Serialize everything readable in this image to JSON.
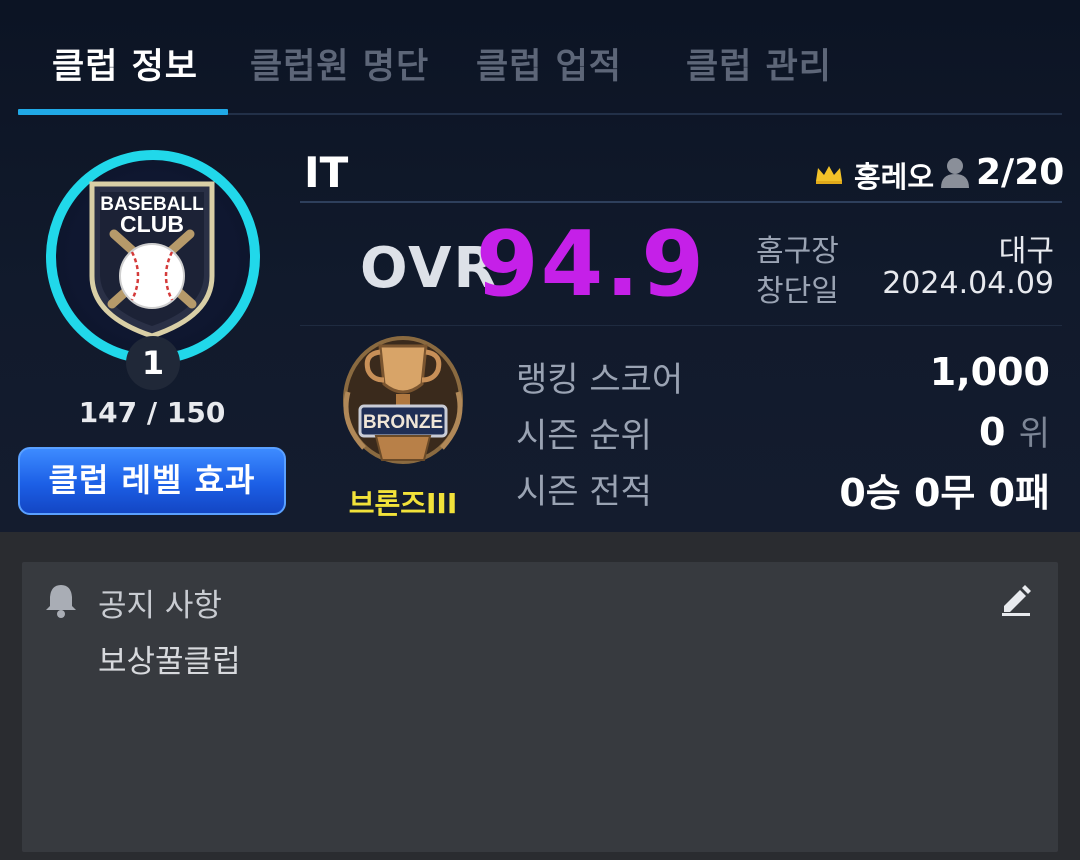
{
  "tabs": [
    {
      "label": "클럽 정보",
      "active": true
    },
    {
      "label": "클럽원 명단",
      "active": false
    },
    {
      "label": "클럽 업적",
      "active": false
    },
    {
      "label": "클럽 관리",
      "active": false
    }
  ],
  "emblem": {
    "text_line1": "BASEBALL",
    "text_line2": "CLUB",
    "level": "1",
    "exp": "147 / 150"
  },
  "level_effect_button": "클럽 레벨 효과",
  "club": {
    "name": "IT",
    "leader": "홍레오",
    "members": "2/20",
    "ovr_label": "OVR",
    "ovr_value": "94.9",
    "home_label": "홈구장",
    "home_value": "대구",
    "founded_label": "창단일",
    "founded_value": "2024.04.09"
  },
  "tier": {
    "badge_text": "BRONZE",
    "name": "브론즈III"
  },
  "stats": {
    "ranking_label": "랭킹 스코어",
    "ranking_value": "1,000",
    "season_rank_label": "시즌 순위",
    "season_rank_value": "0",
    "season_rank_unit": "위",
    "season_record_label": "시즌 전적",
    "season_record_value": "0승 0무 0패"
  },
  "notice": {
    "title": "공지 사항",
    "body": "보상꿀클럽"
  },
  "colors": {
    "accent_tab": "#20a9e6",
    "ovr": "#c520e8",
    "ring": "#21d8ea",
    "tier": "#f2e23a",
    "button": "#1c5fe6"
  },
  "icons": [
    "crown-icon",
    "member-icon",
    "bell-icon",
    "edit-icon"
  ]
}
